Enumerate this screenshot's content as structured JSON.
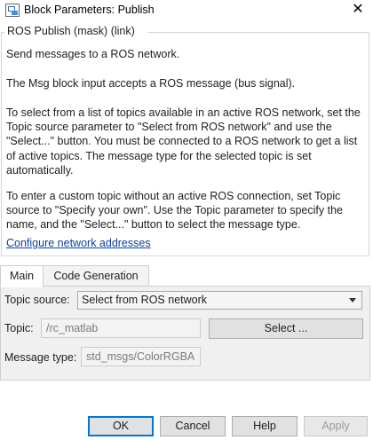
{
  "window": {
    "title": "Block Parameters: Publish",
    "close_glyph": "✕"
  },
  "group": {
    "legend": "ROS Publish (mask) (link)",
    "paragraphs": [
      "Send messages to a ROS network.",
      "The Msg block input accepts a ROS message (bus signal).",
      "To select from a list of topics available in an active ROS network, set the Topic source parameter to \"Select from ROS network\" and use the \"Select...\" button. You must be connected to a ROS network to get a list of active topics. The message type for the selected topic is set automatically.",
      "To enter a custom topic without an active ROS connection, set Topic source to \"Specify your own\". Use the Topic parameter to specify the name, and the \"Select...\" button to select the message type."
    ],
    "link": "Configure network addresses"
  },
  "tabs": [
    {
      "label": "Main",
      "active": true
    },
    {
      "label": "Code Generation",
      "active": false
    }
  ],
  "main": {
    "topic_source_label": "Topic source:",
    "topic_source_value": "Select from ROS network",
    "topic_label": "Topic:",
    "topic_value": "/rc_matlab",
    "select_button": "Select ...",
    "message_type_label": "Message type:",
    "message_type_value": "std_msgs/ColorRGBA"
  },
  "buttons": {
    "ok": "OK",
    "cancel": "Cancel",
    "help": "Help",
    "apply": "Apply"
  },
  "colors": {
    "link": "#0b3fa8",
    "default_button_border": "#0078d7"
  },
  "icons": {
    "app": "block-parameters-icon",
    "close": "close-icon",
    "dropdown": "chevron-down-icon"
  }
}
